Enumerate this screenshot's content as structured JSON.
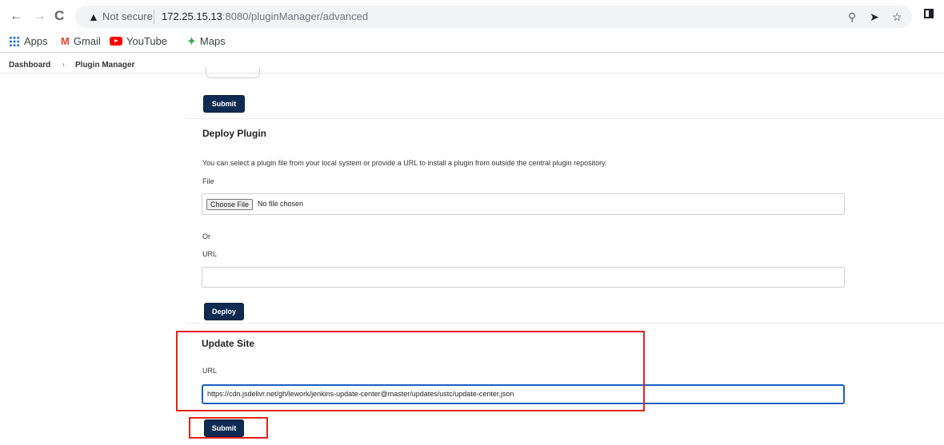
{
  "browser": {
    "back_icon": "arrow-left-icon",
    "forward_icon": "arrow-right-icon",
    "reload_icon": "reload-icon",
    "security_label": "Not secure",
    "url_host": "172.25.15.13",
    "url_path": ":8080/pluginManager/advanced",
    "zoom_icon": "zoom-icon",
    "share_icon": "send-icon",
    "bookmark_icon": "star-icon",
    "panel_icon": "side-panel-icon"
  },
  "bookmarks": [
    {
      "label": "Apps",
      "icon": "apps-grid-icon"
    },
    {
      "label": "Gmail",
      "icon": "gmail-icon"
    },
    {
      "label": "YouTube",
      "icon": "youtube-icon"
    },
    {
      "label": "Maps",
      "icon": "maps-icon"
    }
  ],
  "breadcrumb": {
    "items": [
      "Dashboard",
      "Plugin Manager"
    ],
    "separator": "›"
  },
  "proxy_section": {
    "submit_label": "Submit"
  },
  "deploy": {
    "title": "Deploy Plugin",
    "description": "You can select a plugin file from your local system or provide a URL to install a plugin from outside the central plugin repository.",
    "file_label": "File",
    "choose_file_label": "Choose File",
    "no_file_text": "No file chosen",
    "or_text": "Or",
    "url_label": "URL",
    "url_value": "",
    "deploy_label": "Deploy"
  },
  "update_site": {
    "title": "Update Site",
    "url_label": "URL",
    "url_value": "https://cdn.jsdelivr.net/gh/lework/jenkins-update-center@master/updates/ustc/update-center.json",
    "submit_label": "Submit"
  },
  "colors": {
    "primary_button": "#0e2b52",
    "highlight": "#e2231a",
    "focus_border": "#1a5fc7"
  }
}
